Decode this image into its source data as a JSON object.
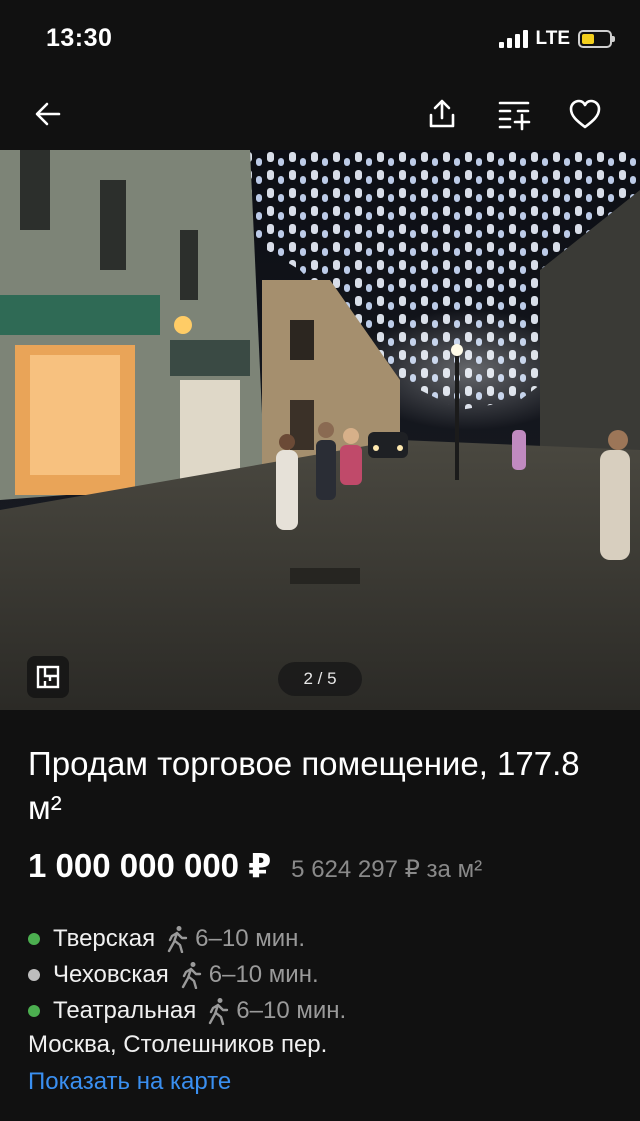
{
  "status_bar": {
    "time": "13:30",
    "network": "LTE",
    "colors": {
      "battery_fill": "#f3cf1c"
    }
  },
  "nav": {
    "icons": [
      "arrow-left-icon",
      "share-icon",
      "compare-icon",
      "heart-icon"
    ]
  },
  "gallery": {
    "counter": "2 / 5",
    "plan_icon": "floor-plan-icon"
  },
  "listing": {
    "title": "Продам торговое помещение, 177.8 м²",
    "price": "1 000 000 000 ₽",
    "price_per_sqm": "5 624 297 ₽ за м²",
    "metro": [
      {
        "name": "Тверская",
        "time": "6–10 мин.",
        "color": "#4caf50",
        "icon": "walk-icon"
      },
      {
        "name": "Чеховская",
        "time": "6–10 мин.",
        "color": "#bdbdbd",
        "icon": "walk-icon"
      },
      {
        "name": "Театральная",
        "time": "6–10 мин.",
        "color": "#4caf50",
        "icon": "walk-icon"
      }
    ],
    "address": "Москва, Столешников пер.",
    "map_link": "Показать на карте"
  },
  "colors": {
    "background": "#111111",
    "link": "#3a8ff0",
    "secondary_text": "#8a8a8a"
  }
}
